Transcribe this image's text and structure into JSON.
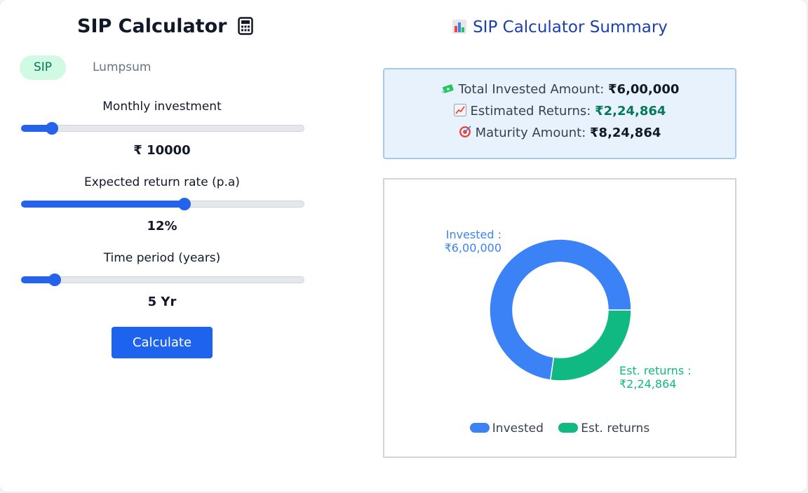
{
  "app": {
    "title": "SIP Calculator",
    "icon": "calculator-icon"
  },
  "tabs": [
    {
      "label": "SIP",
      "active": true
    },
    {
      "label": "Lumpsum",
      "active": false
    }
  ],
  "fields": [
    {
      "label": "Monthly investment",
      "display": "₹ 10000",
      "value": 10000,
      "unit": "₹",
      "slider_fraction": 0.11
    },
    {
      "label": "Expected return rate (p.a)",
      "display": "12%",
      "value": 12,
      "unit": "%",
      "slider_fraction": 0.58
    },
    {
      "label": "Time period (years)",
      "display": "5 Yr",
      "value": 5,
      "unit": "Yr",
      "slider_fraction": 0.12
    }
  ],
  "calculate_label": "Calculate",
  "summary": {
    "title": "SIP Calculator Summary",
    "title_icon": "bar-chart-icon",
    "rows": [
      {
        "icon": "money-with-wings-icon",
        "label": "Total Invested Amount:",
        "value": "₹6,00,000"
      },
      {
        "icon": "chart-increasing-icon",
        "label": "Estimated Returns:",
        "value": "₹2,24,864"
      },
      {
        "icon": "direct-hit-icon",
        "label": "Maturity Amount:",
        "value": "₹8,24,864"
      }
    ]
  },
  "chart_data": {
    "type": "pie",
    "variant": "donut",
    "categories": [
      "Invested",
      "Est. returns"
    ],
    "values": [
      600000,
      224864
    ],
    "data_labels": [
      {
        "name": "Invested :",
        "value": "₹6,00,000"
      },
      {
        "name": "Est. returns :",
        "value": "₹2,24,864"
      }
    ],
    "colors": [
      "#3b82f6",
      "#10b981"
    ],
    "legend": "bottom",
    "legend_items": [
      "Invested",
      "Est. returns"
    ]
  },
  "colors": {
    "primary": "#2563eb",
    "button": "#1d63ed",
    "tab_active_bg": "#d1fae5",
    "tab_active_text": "#047857",
    "summary_title": "#1e40af",
    "returns_text": "#047857"
  }
}
